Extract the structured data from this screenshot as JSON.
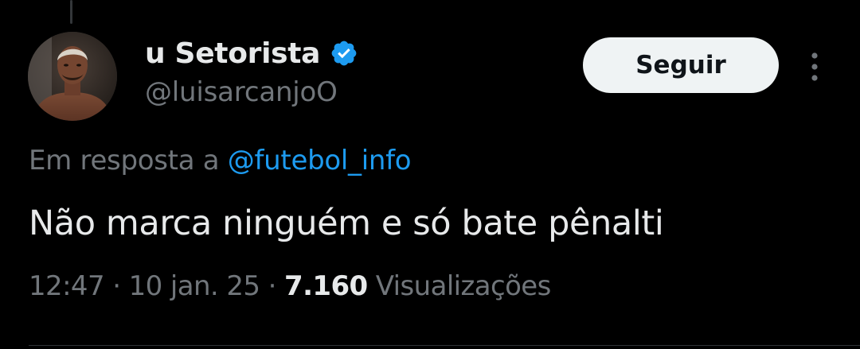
{
  "tweet": {
    "author": {
      "display_name": "u Setorista",
      "handle": "@luisarcanjoO",
      "verified": true
    },
    "follow_label": "Seguir",
    "reply_prefix": "Em resposta a ",
    "reply_to": "@futebol_info",
    "text": "Não marca ninguém e só bate pênalti",
    "time": "12:47",
    "separator": " · ",
    "date": "10 jan. 25",
    "views_count": "7.160",
    "views_label": " Visualizações"
  },
  "colors": {
    "background": "#000000",
    "text_primary": "#e7e9ea",
    "text_secondary": "#71767b",
    "accent_blue": "#1d9bf0",
    "button_bg": "#eff3f4"
  },
  "icons": {
    "verified": "verified-badge-icon",
    "more": "more-vertical-icon",
    "avatar": "avatar-photo"
  }
}
